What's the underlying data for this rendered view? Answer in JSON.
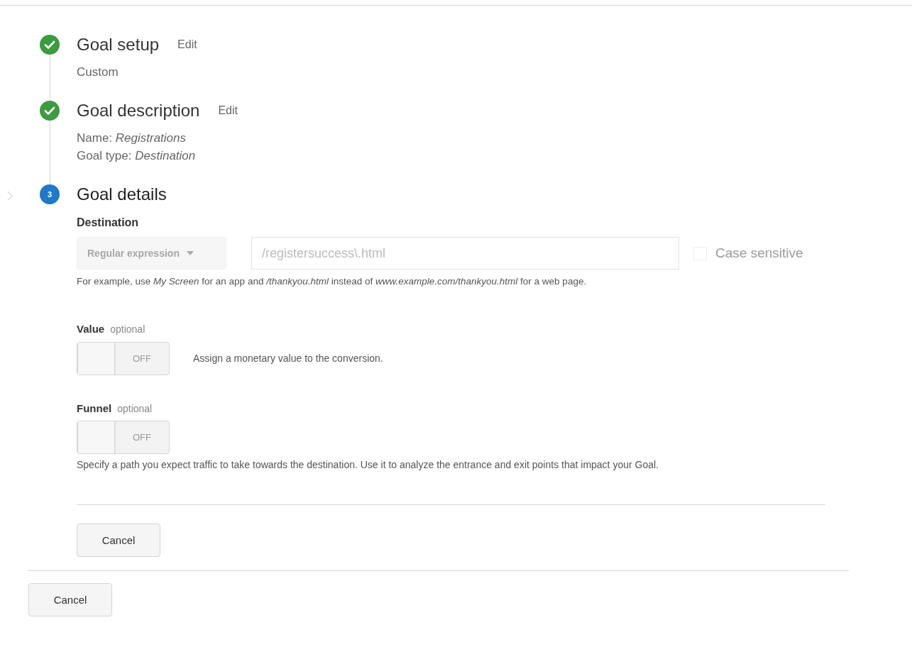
{
  "steps": [
    {
      "kind": "done",
      "title": "Goal setup",
      "edit": "Edit",
      "lines": [
        "Custom"
      ]
    },
    {
      "kind": "done",
      "title": "Goal description",
      "edit": "Edit",
      "lines": [
        "Name: *Registrations*",
        "Goal type: *Destination*"
      ]
    },
    {
      "kind": "current",
      "number": "3",
      "title": "Goal details"
    }
  ],
  "destination": {
    "label": "Destination",
    "match_type": {
      "value": "Regular expression",
      "disabled": true
    },
    "url": {
      "value": "/registersuccess\\.html",
      "disabled": true
    },
    "case_sensitive": {
      "label": "Case sensitive",
      "checked": false
    },
    "hint": "For example, use *My Screen* for an app and */thankyou.html* instead of *www.example.com/thankyou.html* for a web page."
  },
  "options": [
    {
      "kind": "inline",
      "label": "Value",
      "tag": "optional",
      "toggle": {
        "on": false,
        "off_label": "OFF"
      },
      "description": "Assign a monetary value to the conversion."
    },
    {
      "kind": "stacked",
      "label": "Funnel",
      "tag": "optional",
      "toggle": {
        "on": false,
        "off_label": "OFF"
      },
      "description": "Specify a path you expect traffic to take towards the destination. Use it to analyze the entrance and exit points that impact your Goal."
    }
  ],
  "inner_button": "Cancel",
  "outer_button": "Cancel"
}
